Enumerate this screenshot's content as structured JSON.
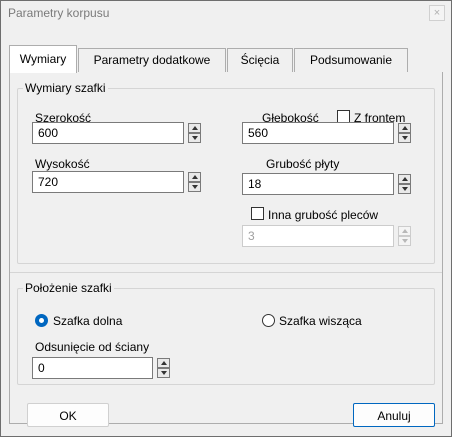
{
  "window": {
    "title": "Parametry korpusu",
    "close_glyph": "×"
  },
  "tabs": [
    {
      "label": "Wymiary",
      "active": true
    },
    {
      "label": "Parametry dodatkowe",
      "active": false
    },
    {
      "label": "Ścięcia",
      "active": false
    },
    {
      "label": "Podsumowanie",
      "active": false
    }
  ],
  "dimensions": {
    "group_label": "Wymiary szafki",
    "width": {
      "label": "Szerokość",
      "value": "600"
    },
    "depth": {
      "label": "Głębokość",
      "value": "560"
    },
    "with_front": {
      "label": "Z frontem",
      "checked": false
    },
    "height": {
      "label": "Wysokość",
      "value": "720"
    },
    "board_thickness": {
      "label": "Grubość płyty",
      "value": "18"
    },
    "other_back_thickness": {
      "label": "Inna grubość pleców",
      "checked": false
    },
    "back_thickness": {
      "value": "3",
      "enabled": false
    }
  },
  "position": {
    "group_label": "Położenie szafki",
    "floor_option": {
      "label": "Szafka dolna",
      "selected": true
    },
    "wall_option": {
      "label": "Szafka wisząca",
      "selected": false
    },
    "offset": {
      "label": "Odsunięcie od ściany",
      "value": "0"
    }
  },
  "buttons": {
    "ok": "OK",
    "cancel": "Anuluj"
  },
  "colors": {
    "accent": "#0067c0",
    "window_bg": "#f0f0f0"
  }
}
